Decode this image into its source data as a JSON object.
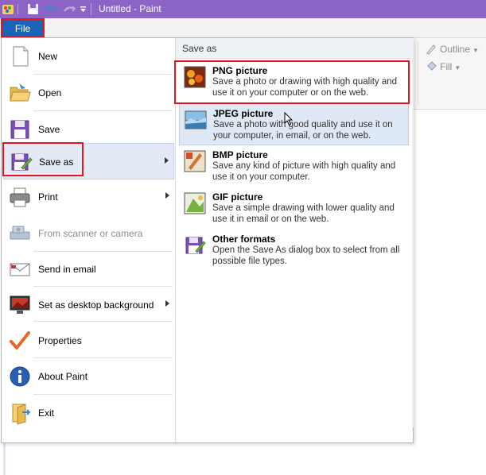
{
  "window": {
    "title": "Untitled - Paint",
    "file_tab": "File"
  },
  "ribbon": {
    "outline": "Outline",
    "fill": "Fill"
  },
  "menu": {
    "items": [
      {
        "label": "New"
      },
      {
        "label": "Open"
      },
      {
        "label": "Save"
      },
      {
        "label": "Save as"
      },
      {
        "label": "Print"
      },
      {
        "label": "From scanner or camera"
      },
      {
        "label": "Send in email"
      },
      {
        "label": "Set as desktop background"
      },
      {
        "label": "Properties"
      },
      {
        "label": "About Paint"
      },
      {
        "label": "Exit"
      }
    ]
  },
  "submenu": {
    "header": "Save as",
    "items": [
      {
        "title": "PNG picture",
        "desc": "Save a photo or drawing with high quality and use it on your computer or on the web."
      },
      {
        "title": "JPEG picture",
        "desc": "Save a photo with good quality and use it on your computer, in email, or on the web."
      },
      {
        "title": "BMP picture",
        "desc": "Save any kind of picture with high quality and use it on your computer."
      },
      {
        "title": "GIF picture",
        "desc": "Save a simple drawing with lower quality and use it in email or on the web."
      },
      {
        "title": "Other formats",
        "desc": "Open the Save As dialog box to select from all possible file types."
      }
    ]
  },
  "colors": {
    "titlebar": "#8b64c5",
    "file_tab": "#1a64b8",
    "highlight_outline": "#e5141e",
    "selected_bg": "#e4eaf5"
  }
}
